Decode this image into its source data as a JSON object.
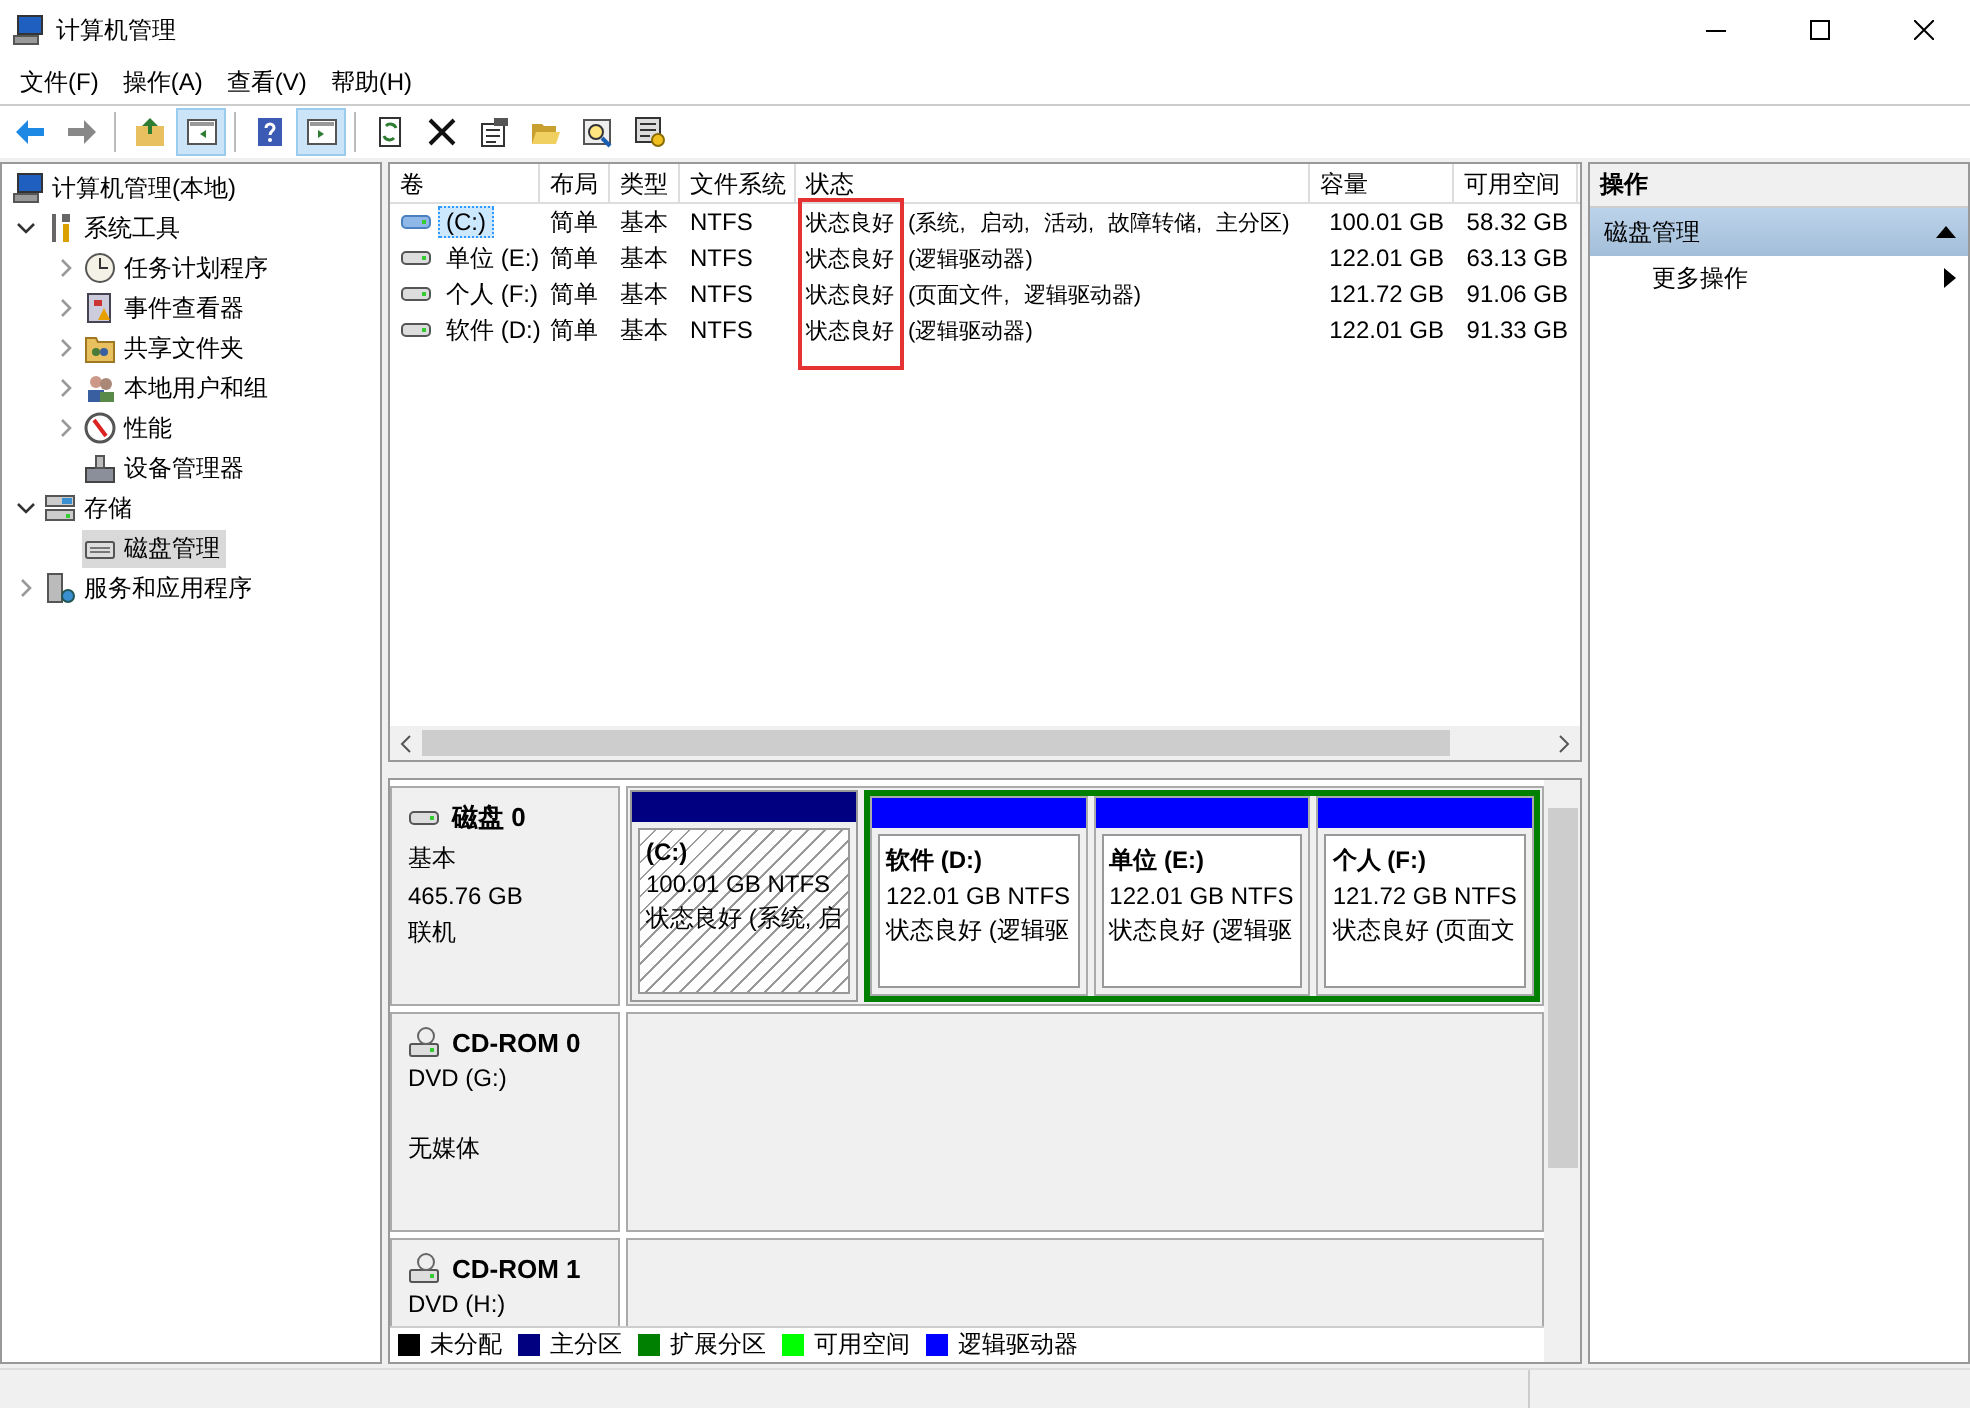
{
  "window": {
    "title": "计算机管理"
  },
  "menu": [
    "文件(F)",
    "操作(A)",
    "查看(V)",
    "帮助(H)"
  ],
  "toolbar": [
    {
      "kind": "back",
      "pressed": false
    },
    {
      "kind": "forward",
      "pressed": false
    },
    {
      "kind": "separator"
    },
    {
      "kind": "up",
      "pressed": false
    },
    {
      "kind": "tree-pane",
      "pressed": true
    },
    {
      "kind": "separator"
    },
    {
      "kind": "help",
      "pressed": false
    },
    {
      "kind": "action-pane",
      "pressed": true
    },
    {
      "kind": "separator"
    },
    {
      "kind": "refresh",
      "pressed": false
    },
    {
      "kind": "delete",
      "pressed": false
    },
    {
      "kind": "properties",
      "pressed": false
    },
    {
      "kind": "open",
      "pressed": false
    },
    {
      "kind": "search",
      "pressed": false
    },
    {
      "kind": "settings",
      "pressed": false
    }
  ],
  "tree": [
    {
      "label": "计算机管理(本地)",
      "kind": "computer",
      "selected": false,
      "children": [
        {
          "label": "系统工具",
          "kind": "tools",
          "selected": false,
          "expanded": true,
          "children": [
            {
              "label": "任务计划程序",
              "kind": "clock",
              "selected": false,
              "expanded": false
            },
            {
              "label": "事件查看器",
              "kind": "event",
              "selected": false,
              "expanded": false
            },
            {
              "label": "共享文件夹",
              "kind": "share",
              "selected": false,
              "expanded": false
            },
            {
              "label": "本地用户和组",
              "kind": "users",
              "selected": false,
              "expanded": false
            },
            {
              "label": "性能",
              "kind": "perf",
              "selected": false,
              "expanded": false
            },
            {
              "label": "设备管理器",
              "kind": "device",
              "selected": false
            }
          ]
        },
        {
          "label": "存储",
          "kind": "storage",
          "selected": false,
          "expanded": true,
          "children": [
            {
              "label": "磁盘管理",
              "kind": "disk",
              "selected": true
            }
          ]
        },
        {
          "label": "服务和应用程序",
          "kind": "services",
          "selected": false,
          "expanded": false
        }
      ]
    }
  ],
  "table": {
    "columns": [
      "卷",
      "布局",
      "类型",
      "文件系统",
      "状态",
      "容量",
      "可用空间"
    ],
    "rows": [
      {
        "selected": true,
        "cells": [
          "(C:)",
          "简单",
          "基本",
          "NTFS",
          "状态良好 (系统, 启动, 活动, 故障转储, 主分区)",
          "100.01 GB",
          "58.32 GB"
        ]
      },
      {
        "selected": false,
        "cells": [
          "单位 (E:)",
          "简单",
          "基本",
          "NTFS",
          "状态良好 (逻辑驱动器)",
          "122.01 GB",
          "63.13 GB"
        ]
      },
      {
        "selected": false,
        "cells": [
          "个人 (F:)",
          "简单",
          "基本",
          "NTFS",
          "状态良好 (页面文件, 逻辑驱动器)",
          "121.72 GB",
          "91.06 GB"
        ]
      },
      {
        "selected": false,
        "cells": [
          "软件 (D:)",
          "简单",
          "基本",
          "NTFS",
          "状态良好 (逻辑驱动器)",
          "122.01 GB",
          "91.33 GB"
        ]
      }
    ]
  },
  "disks": [
    {
      "name": "磁盘 0",
      "kind": "disk",
      "type": "基本",
      "size": "465.76 GB",
      "status": "联机",
      "partitions": [
        {
          "kind": "primary",
          "name": "(C:)",
          "size": "100.01 GB NTFS",
          "status": "状态良好 (系统, 启",
          "selected": true
        },
        {
          "kind": "extended",
          "children": [
            {
              "kind": "logical",
              "name": "软件  (D:)",
              "size": "122.01 GB NTFS",
              "status": "状态良好 (逻辑驱",
              "selected": false
            },
            {
              "kind": "logical",
              "name": "单位  (E:)",
              "size": "122.01 GB NTFS",
              "status": "状态良好 (逻辑驱",
              "selected": false
            },
            {
              "kind": "logical",
              "name": "个人  (F:)",
              "size": "121.72 GB NTFS",
              "status": "状态良好 (页面文",
              "selected": false
            }
          ]
        }
      ]
    },
    {
      "name": "CD-ROM 0",
      "kind": "cdrom",
      "type": "DVD (G:)",
      "status": "无媒体"
    },
    {
      "name": "CD-ROM 1",
      "kind": "cdrom",
      "type": "DVD (H:)"
    }
  ],
  "legend": [
    {
      "label": "未分配",
      "color": "#000000"
    },
    {
      "label": "主分区",
      "color": "#000080"
    },
    {
      "label": "扩展分区",
      "color": "#008000"
    },
    {
      "label": "可用空间",
      "color": "#00ff00"
    },
    {
      "label": "逻辑驱动器",
      "color": "#0000ff"
    }
  ],
  "actions": {
    "title": "操作",
    "sections": [
      {
        "label": "磁盘管理",
        "expanded": true,
        "items": [
          "更多操作"
        ]
      }
    ]
  }
}
